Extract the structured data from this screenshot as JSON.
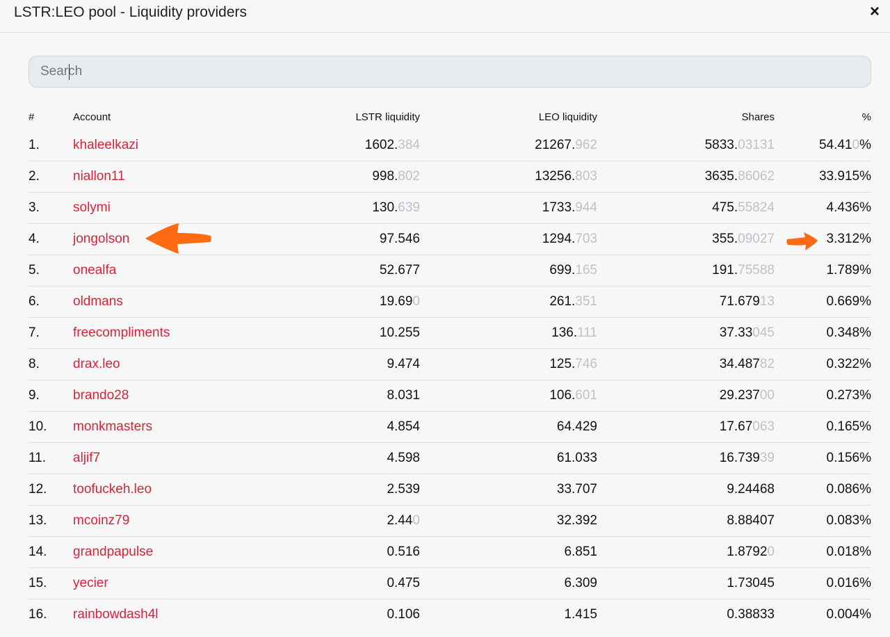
{
  "header": {
    "title": "LSTR:LEO pool - Liquidity providers",
    "close_label": "×"
  },
  "search": {
    "placeholder": "Search",
    "value": ""
  },
  "table": {
    "columns": [
      "#",
      "Account",
      "LSTR liquidity",
      "LEO liquidity",
      "Shares",
      "%"
    ],
    "rows": [
      {
        "rank": "1.",
        "account": "khaleelkazi",
        "lstr": [
          "1602.",
          "384"
        ],
        "leo": [
          "21267.",
          "962"
        ],
        "shares": [
          "5833.",
          "03131"
        ],
        "pct": [
          "54.41",
          "0",
          "%"
        ]
      },
      {
        "rank": "2.",
        "account": "niallon11",
        "lstr": [
          "998.",
          "802"
        ],
        "leo": [
          "13256.",
          "803"
        ],
        "shares": [
          "3635.",
          "86062"
        ],
        "pct": [
          "33.915",
          "",
          "%"
        ]
      },
      {
        "rank": "3.",
        "account": "solymi",
        "lstr": [
          "130.",
          "639"
        ],
        "leo": [
          "1733.",
          "944"
        ],
        "shares": [
          "475.",
          "55824"
        ],
        "pct": [
          "4.436",
          "",
          "%"
        ]
      },
      {
        "rank": "4.",
        "account": "jongolson",
        "lstr": [
          "97.546",
          ""
        ],
        "leo": [
          "1294.",
          "703"
        ],
        "shares": [
          "355.",
          "09027"
        ],
        "pct": [
          "3.312",
          "",
          "%"
        ]
      },
      {
        "rank": "5.",
        "account": "onealfa",
        "lstr": [
          "52.677",
          ""
        ],
        "leo": [
          "699.",
          "165"
        ],
        "shares": [
          "191.",
          "75588"
        ],
        "pct": [
          "1.789",
          "",
          "%"
        ]
      },
      {
        "rank": "6.",
        "account": "oldmans",
        "lstr": [
          "19.69",
          "0"
        ],
        "leo": [
          "261.",
          "351"
        ],
        "shares": [
          "71.679",
          "13"
        ],
        "pct": [
          "0.669",
          "",
          "%"
        ]
      },
      {
        "rank": "7.",
        "account": "freecompliments",
        "lstr": [
          "10.255",
          ""
        ],
        "leo": [
          "136.",
          "111"
        ],
        "shares": [
          "37.33",
          "045"
        ],
        "pct": [
          "0.348",
          "",
          "%"
        ]
      },
      {
        "rank": "8.",
        "account": "drax.leo",
        "lstr": [
          "9.474",
          ""
        ],
        "leo": [
          "125.",
          "746"
        ],
        "shares": [
          "34.487",
          "82"
        ],
        "pct": [
          "0.322",
          "",
          "%"
        ]
      },
      {
        "rank": "9.",
        "account": "brando28",
        "lstr": [
          "8.031",
          ""
        ],
        "leo": [
          "106.",
          "601"
        ],
        "shares": [
          "29.237",
          "00"
        ],
        "pct": [
          "0.273",
          "",
          "%"
        ]
      },
      {
        "rank": "10.",
        "account": "monkmasters",
        "lstr": [
          "4.854",
          ""
        ],
        "leo": [
          "64.429",
          ""
        ],
        "shares": [
          "17.67",
          "063"
        ],
        "pct": [
          "0.165",
          "",
          "%"
        ]
      },
      {
        "rank": "11.",
        "account": "aljif7",
        "lstr": [
          "4.598",
          ""
        ],
        "leo": [
          "61.033",
          ""
        ],
        "shares": [
          "16.739",
          "39"
        ],
        "pct": [
          "0.156",
          "",
          "%"
        ]
      },
      {
        "rank": "12.",
        "account": "toofuckeh.leo",
        "lstr": [
          "2.539",
          ""
        ],
        "leo": [
          "33.707",
          ""
        ],
        "shares": [
          "9.24468",
          ""
        ],
        "pct": [
          "0.086",
          "",
          "%"
        ]
      },
      {
        "rank": "13.",
        "account": "mcoinz79",
        "lstr": [
          "2.44",
          "0"
        ],
        "leo": [
          "32.392",
          ""
        ],
        "shares": [
          "8.88407",
          ""
        ],
        "pct": [
          "0.083",
          "",
          "%"
        ]
      },
      {
        "rank": "14.",
        "account": "grandpapulse",
        "lstr": [
          "0.516",
          ""
        ],
        "leo": [
          "6.851",
          ""
        ],
        "shares": [
          "1.8792",
          "0"
        ],
        "pct": [
          "0.018",
          "",
          "%"
        ]
      },
      {
        "rank": "15.",
        "account": "yecier",
        "lstr": [
          "0.475",
          ""
        ],
        "leo": [
          "6.309",
          ""
        ],
        "shares": [
          "1.73045",
          ""
        ],
        "pct": [
          "0.016",
          "",
          "%"
        ]
      },
      {
        "rank": "16.",
        "account": "rainbowdash4l",
        "lstr": [
          "0.106",
          ""
        ],
        "leo": [
          "1.415",
          ""
        ],
        "shares": [
          "0.38833",
          ""
        ],
        "pct": [
          "0.004",
          "",
          "%"
        ]
      }
    ]
  },
  "colors": {
    "account_link": "#d4243a",
    "dim_digits": "#bcc2c8",
    "annotation_arrow": "#ff6a13"
  },
  "annotations": {
    "arrows": [
      "arrow-left-icon",
      "arrow-right-icon"
    ]
  }
}
